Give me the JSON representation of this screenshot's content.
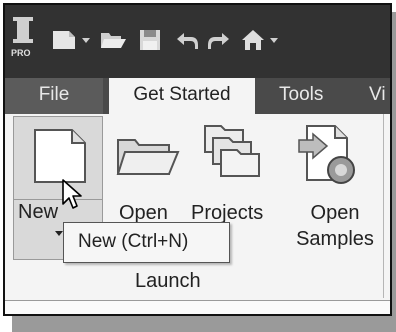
{
  "app": {
    "logo_badge": "PRO"
  },
  "tabs": [
    {
      "label": "File"
    },
    {
      "label": "Get Started"
    },
    {
      "label": "Tools"
    },
    {
      "label": "Vi"
    }
  ],
  "ribbon": {
    "new_button": {
      "label": "New"
    },
    "open_button": {
      "label": "Open"
    },
    "projects_button": {
      "label": "Projects"
    },
    "open_samples_button": {
      "label": "Open Samples",
      "line1": "Open",
      "line2": "Samples"
    },
    "group_label": "Launch"
  },
  "tooltip": {
    "text": "New (Ctrl+N)"
  },
  "icons": {
    "quick_access": [
      "new-file-icon",
      "dropdown-icon",
      "open-icon",
      "save-icon",
      "undo-icon",
      "redo-icon",
      "home-icon"
    ]
  }
}
